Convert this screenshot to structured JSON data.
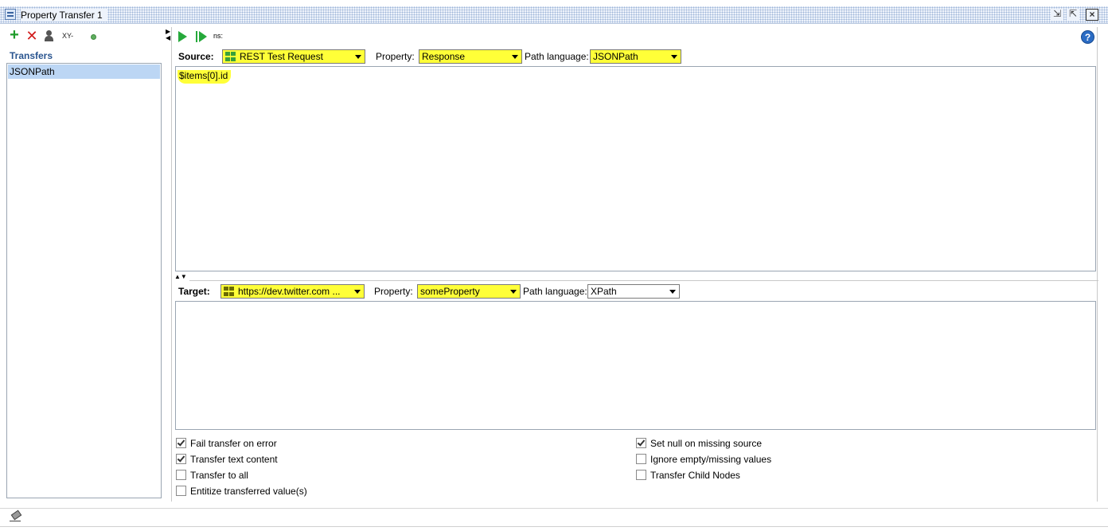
{
  "window": {
    "title": "Property Transfer 1",
    "buttons": [
      "minimize",
      "maximize",
      "close"
    ]
  },
  "left_toolbar": {
    "xy_label": "XY-"
  },
  "transfers": {
    "heading": "Transfers",
    "items": [
      "JSONPath"
    ],
    "selected": "JSONPath"
  },
  "right_toolbar": {
    "ns_label": "ns:"
  },
  "source": {
    "label": "Source:",
    "step": "REST Test Request",
    "property_label": "Property:",
    "property": "Response",
    "path_language_label": "Path language:",
    "path_language": "JSONPath",
    "expression": "$items[0].id"
  },
  "target": {
    "label": "Target:",
    "step": "https://dev.twitter.com ...",
    "property_label": "Property:",
    "property": "someProperty",
    "path_language_label": "Path language:",
    "path_language": "XPath",
    "expression": ""
  },
  "options": {
    "fail_on_error": {
      "label": "Fail transfer on error",
      "checked": true
    },
    "transfer_text": {
      "label": "Transfer text content",
      "checked": true
    },
    "transfer_to_all": {
      "label": "Transfer to all",
      "checked": false
    },
    "entitize": {
      "label": "Entitize transferred value(s)",
      "checked": false
    },
    "set_null": {
      "label": "Set null on missing source",
      "checked": true
    },
    "ignore_empty": {
      "label": "Ignore empty/missing values",
      "checked": false
    },
    "child_nodes": {
      "label": "Transfer Child Nodes",
      "checked": false
    }
  },
  "icons": [
    "add-icon",
    "delete-icon",
    "person-icon",
    "status-dot-icon",
    "run-icon",
    "run-step-icon",
    "help-icon",
    "eraser-icon"
  ],
  "colors": {
    "highlight": "#ffff38",
    "selection": "#bcd6f4",
    "run_green": "#26a93b",
    "delete_red": "#d11a1a"
  }
}
